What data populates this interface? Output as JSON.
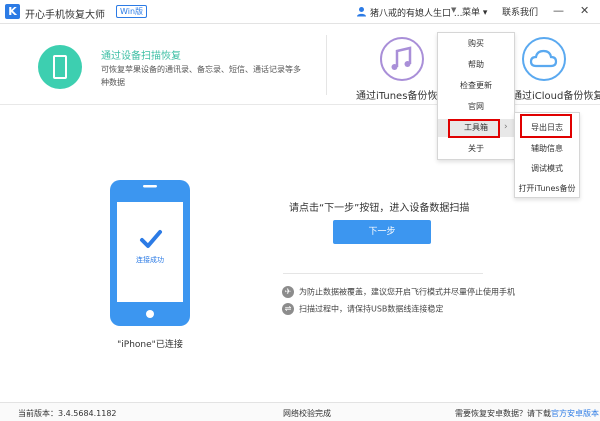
{
  "app": {
    "logo_letter": "K",
    "title": "开心手机恢复大师",
    "edition_badge": "Win版"
  },
  "header": {
    "user_name": "猪八戒的有媳人生口 ...",
    "menu_label": "菜单 ▾",
    "contact_label": "联系我们"
  },
  "recovery_modes": {
    "device_scan": {
      "title": "通过设备扫描恢复",
      "description": "可恢复苹果设备的通讯录、备忘录、短信、通话记录等多种数据"
    },
    "itunes_backup": {
      "label": "通过iTunes备份恢复"
    },
    "icloud_backup": {
      "label": "通过iCloud备份恢复"
    }
  },
  "device_panel": {
    "screen_status": "连接成功",
    "connected_label": "\"iPhone\"已连接"
  },
  "scan_panel": {
    "instruction": "请点击“下一步”按钮，进入设备数据扫描",
    "next_button": "下一步",
    "tips": [
      "为防止数据被覆盖，建议您开启飞行模式并尽量停止使用手机",
      "扫描过程中，请保持USB数据线连接稳定"
    ]
  },
  "menu_dropdown": {
    "items": [
      "购买",
      "帮助",
      "检查更新",
      "官网",
      "工具箱",
      "关于"
    ],
    "active_item": "工具箱"
  },
  "toolbox_submenu": {
    "items": [
      "导出日志",
      "辅助信息",
      "调试模式",
      "打开iTunes备份"
    ],
    "highlighted_item": "导出日志"
  },
  "statusbar": {
    "version_label": "当前版本：3.4.5684.1182",
    "network_status": "网络校验完成",
    "android_prompt": "需要恢复安卓数据？请下载",
    "android_link": "官方安卓版本"
  },
  "colors": {
    "accent": "#3c96f0",
    "brand": "#2c7be5",
    "device_scan_teal": "#3dcfb0",
    "highlight_red": "#e00000",
    "itunes_purple": "#a98fd8",
    "icloud_blue": "#5aa9f0"
  }
}
